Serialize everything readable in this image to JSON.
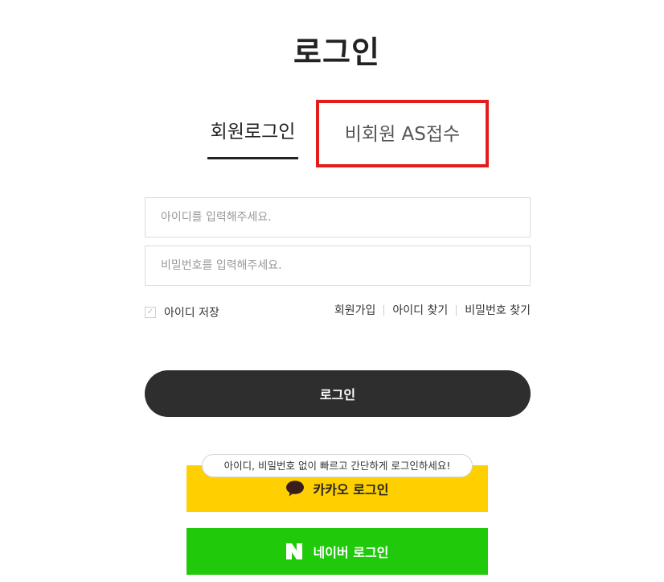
{
  "page": {
    "title": "로그인"
  },
  "tabs": {
    "member": "회원로그인",
    "guest": "비회원 AS접수"
  },
  "form": {
    "id_placeholder": "아이디를 입력해주세요.",
    "pw_placeholder": "비밀번호를 입력해주세요.",
    "save_id_label": "아이디 저장",
    "save_id_checked": false
  },
  "links": {
    "signup": "회원가입",
    "find_id": "아이디 찾기",
    "find_pw": "비밀번호 찾기"
  },
  "buttons": {
    "login": "로그인",
    "kakao": "카카오 로그인",
    "naver": "네이버 로그인"
  },
  "tooltip": {
    "kakao_hint": "아이디, 비밀번호 없이 빠르고 간단하게 로그인하세요!"
  },
  "colors": {
    "kakao": "#fed000",
    "naver": "#20c90a",
    "login": "#2e2e2e",
    "highlight": "#e31c1c"
  },
  "icons": {
    "kakao": "kakao-speech-bubble-icon",
    "naver": "naver-n-icon",
    "checkbox": "check-icon"
  }
}
